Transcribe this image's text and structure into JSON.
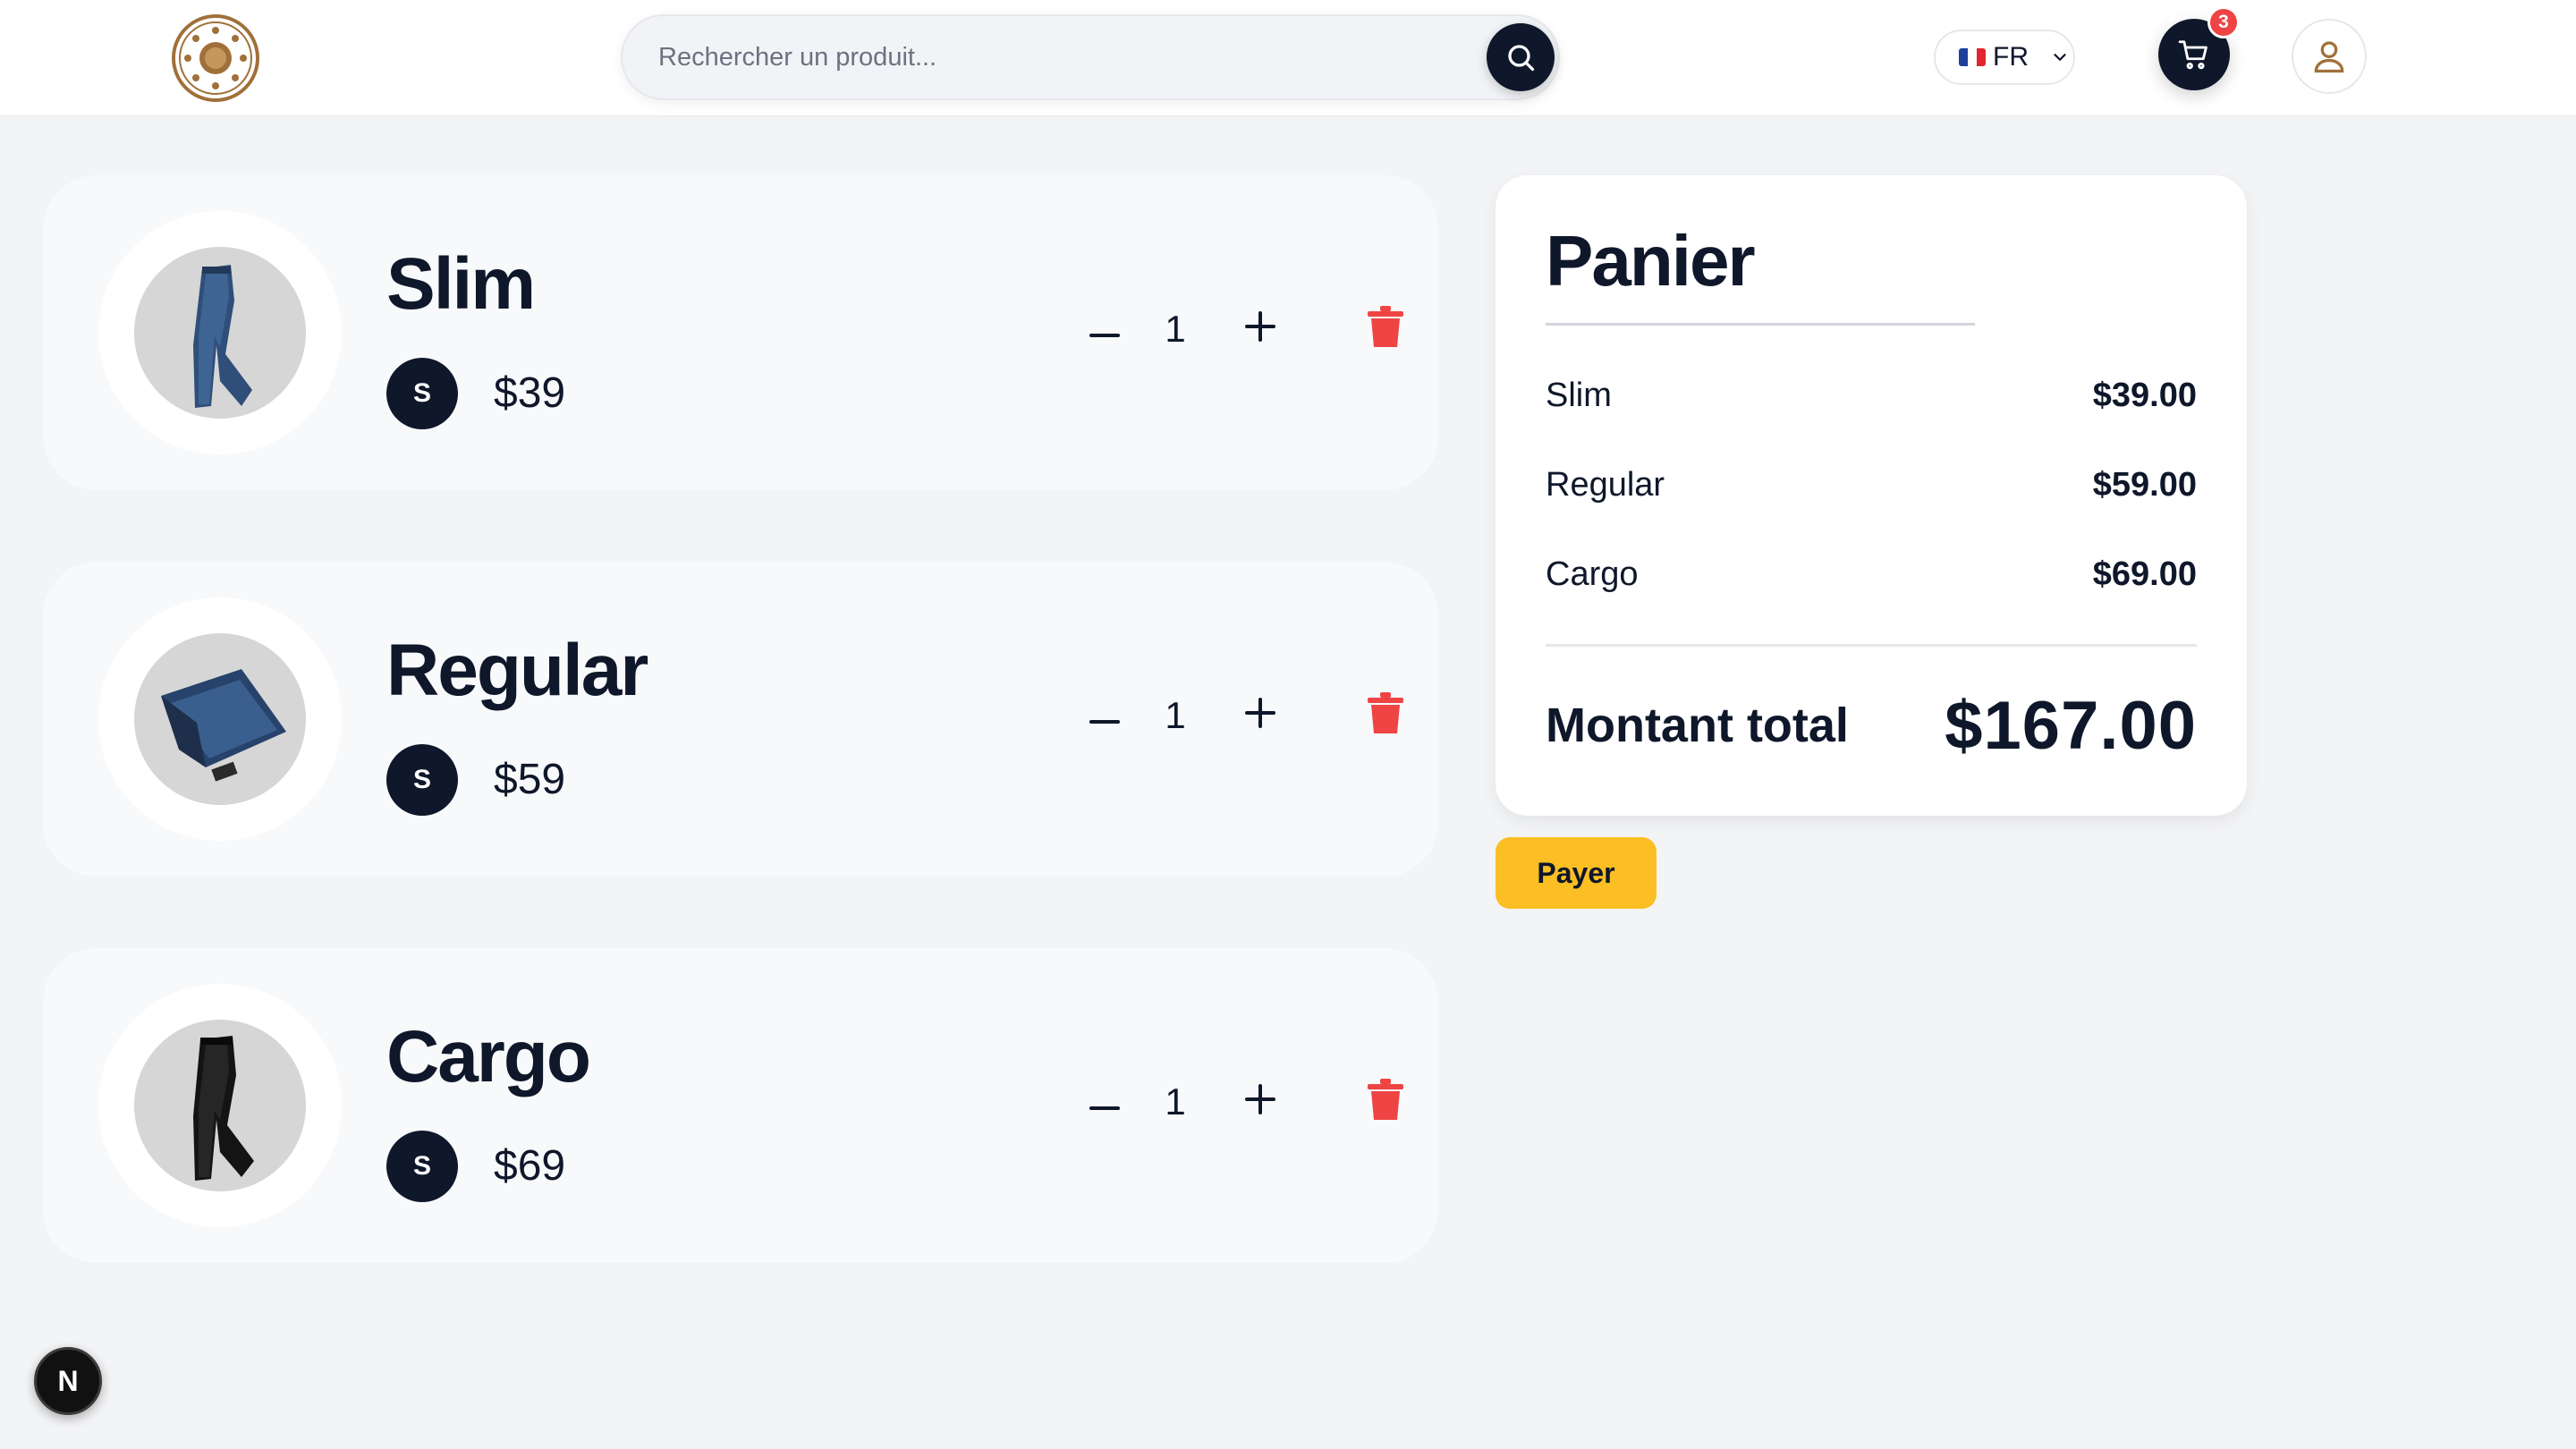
{
  "header": {
    "search_placeholder": "Rechercher un produit...",
    "language": "FR",
    "cart_count": "3"
  },
  "items": [
    {
      "name": "Slim",
      "size": "S",
      "price": "$39",
      "quantity": "1"
    },
    {
      "name": "Regular",
      "size": "S",
      "price": "$59",
      "quantity": "1"
    },
    {
      "name": "Cargo",
      "size": "S",
      "price": "$69",
      "quantity": "1"
    }
  ],
  "summary": {
    "title": "Panier",
    "lines": [
      {
        "label": "Slim",
        "amount": "$39.00"
      },
      {
        "label": "Regular",
        "amount": "$59.00"
      },
      {
        "label": "Cargo",
        "amount": "$69.00"
      }
    ],
    "total_label": "Montant total",
    "total_amount": "$167.00"
  },
  "pay_label": "Payer",
  "dev_badge": "N",
  "colors": {
    "primary": "#0f172a",
    "accent": "#fbbf24",
    "danger": "#ef4444",
    "logo": "#a0703a"
  }
}
